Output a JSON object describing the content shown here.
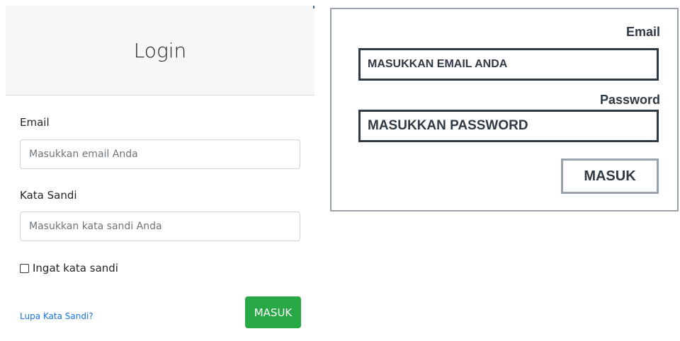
{
  "login_card": {
    "title": "Login",
    "email_label": "Email",
    "email_placeholder": "Masukkan email Anda",
    "password_label": "Kata Sandi",
    "password_placeholder": "Masukkan kata sandi Anda",
    "remember_label": "Ingat kata sandi",
    "forgot_link": "Lupa Kata Sandi?",
    "submit_label": "MASUK"
  },
  "wireframe": {
    "email_label": "Email",
    "email_placeholder": "MASUKKAN EMAIL ANDA",
    "password_label": "Password",
    "password_placeholder": "MASUKKAN PASSWORD",
    "submit_label": "MASUK"
  },
  "colors": {
    "success_button": "#28a745",
    "link": "#1a73e8",
    "wire_dark": "#2f3a45",
    "wire_border": "#9aa3ad"
  }
}
